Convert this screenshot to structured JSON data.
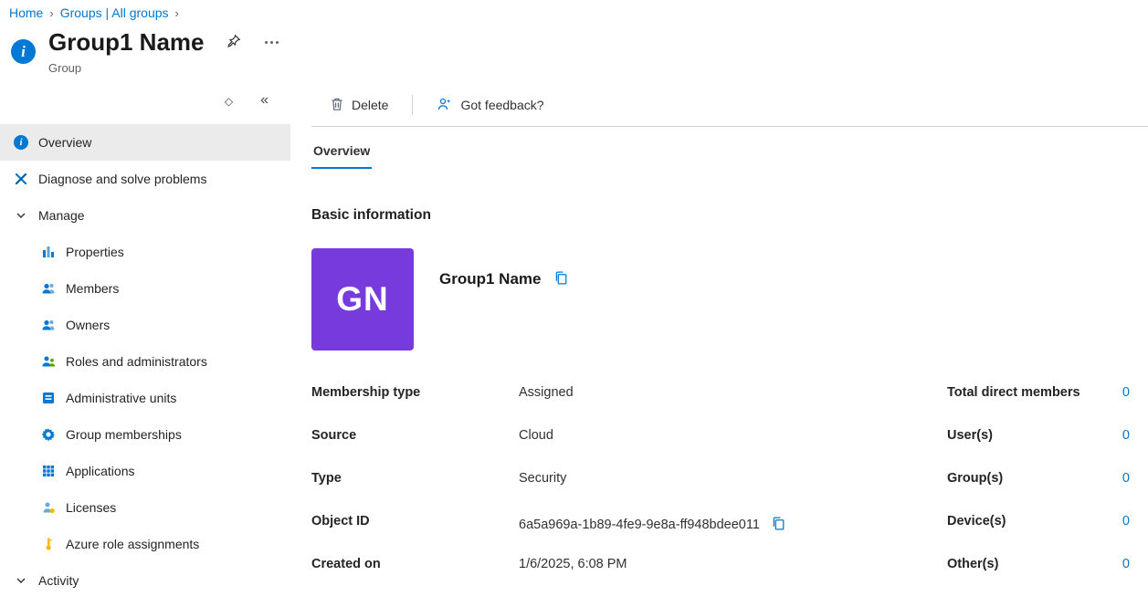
{
  "breadcrumb": {
    "separator": "›",
    "items": [
      {
        "label": "Home"
      },
      {
        "label": "Groups | All groups"
      }
    ]
  },
  "header": {
    "title": "Group1 Name",
    "subtitle": "Group"
  },
  "sidebar": {
    "items": [
      {
        "label": "Overview",
        "icon": "info-icon"
      },
      {
        "label": "Diagnose and solve problems",
        "icon": "diagnose-icon"
      },
      {
        "label": "Manage",
        "icon": "chevron-down-icon"
      },
      {
        "label": "Properties",
        "icon": "properties-icon"
      },
      {
        "label": "Members",
        "icon": "people-icon"
      },
      {
        "label": "Owners",
        "icon": "people-icon"
      },
      {
        "label": "Roles and administrators",
        "icon": "roles-icon"
      },
      {
        "label": "Administrative units",
        "icon": "admin-units-icon"
      },
      {
        "label": "Group memberships",
        "icon": "memberships-icon"
      },
      {
        "label": "Applications",
        "icon": "applications-icon"
      },
      {
        "label": "Licenses",
        "icon": "licenses-icon"
      },
      {
        "label": "Azure role assignments",
        "icon": "key-icon"
      },
      {
        "label": "Activity",
        "icon": "chevron-down-icon"
      }
    ]
  },
  "toolbar": {
    "delete": "Delete",
    "feedback": "Got feedback?"
  },
  "tabs": [
    {
      "label": "Overview"
    }
  ],
  "overview": {
    "section_title": "Basic information",
    "avatar_initials": "GN",
    "group_name": "Group1 Name",
    "fields": [
      {
        "label": "Membership type",
        "value": "Assigned"
      },
      {
        "label": "Source",
        "value": "Cloud"
      },
      {
        "label": "Type",
        "value": "Security"
      },
      {
        "label": "Object ID",
        "value": "6a5a969a-1b89-4fe9-9e8a-ff948bdee011"
      },
      {
        "label": "Created on",
        "value": "1/6/2025, 6:08 PM"
      }
    ],
    "stats": [
      {
        "label": "Total direct members",
        "value": "0"
      },
      {
        "label": "User(s)",
        "value": "0"
      },
      {
        "label": "Group(s)",
        "value": "0"
      },
      {
        "label": "Device(s)",
        "value": "0"
      },
      {
        "label": "Other(s)",
        "value": "0"
      }
    ]
  },
  "colors": {
    "accent": "#0078d4",
    "avatar_bg": "#773adc"
  }
}
